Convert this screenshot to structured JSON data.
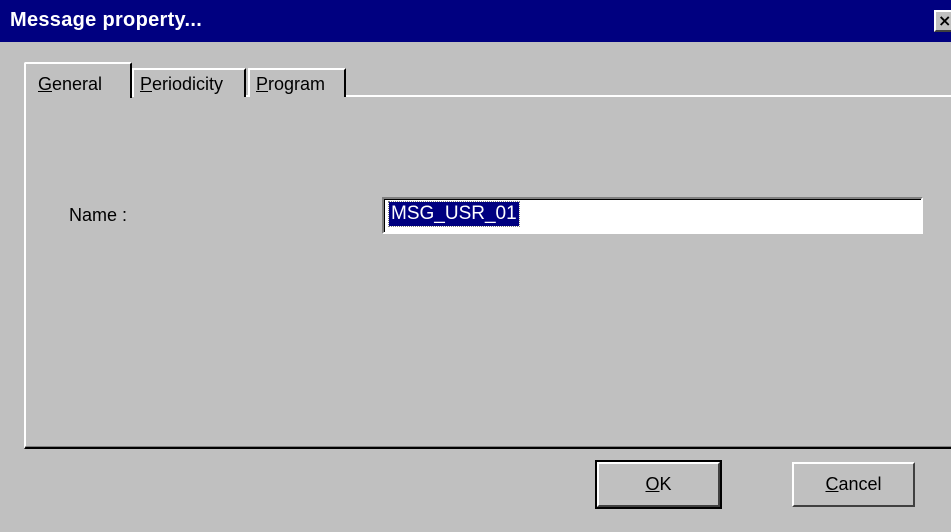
{
  "window": {
    "title": "Message property...",
    "close_glyph": "×"
  },
  "tabs": {
    "general": {
      "first": "G",
      "rest": "eneral"
    },
    "periodicity": {
      "first": "P",
      "rest": "eriodicity"
    },
    "program": {
      "first": "P",
      "rest": "rogram"
    },
    "active": "general"
  },
  "form": {
    "name_label": "Name :",
    "name_value": "MSG_USR_01"
  },
  "buttons": {
    "ok": {
      "first": "O",
      "rest": "K"
    },
    "cancel": {
      "first": "C",
      "rest": "ancel"
    }
  },
  "colors": {
    "titlebar": "#000080",
    "face": "#c0c0c0",
    "selection": "#000080"
  }
}
